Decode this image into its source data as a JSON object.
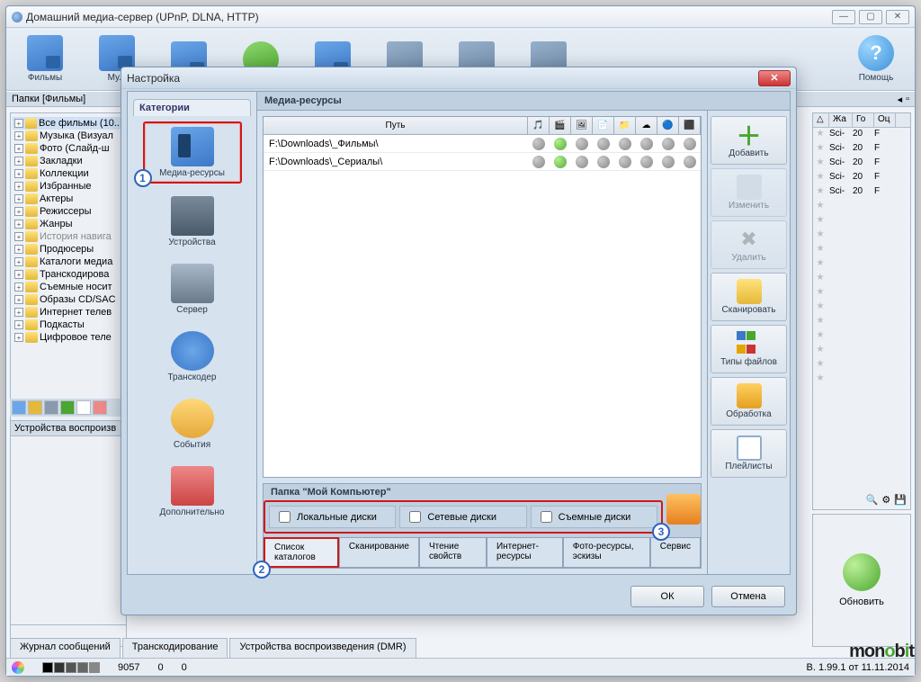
{
  "window": {
    "title": "Домашний медиа-сервер (UPnP, DLNA, HTTP)"
  },
  "toolbar": {
    "items": [
      "Фильмы",
      "Му...",
      "",
      "",
      "",
      "",
      "",
      "",
      ""
    ],
    "help": "Помощь"
  },
  "secondBar": {
    "left": "Папки [Фильмы]"
  },
  "tree": [
    {
      "label": "Все фильмы (10...",
      "sel": true
    },
    {
      "label": "Музыка (Визуал"
    },
    {
      "label": "Фото (Слайд-ш"
    },
    {
      "label": "Закладки"
    },
    {
      "label": "Коллекции"
    },
    {
      "label": "Избранные"
    },
    {
      "label": "Актеры"
    },
    {
      "label": "Режиссеры"
    },
    {
      "label": "Жанры"
    },
    {
      "label": "История навига",
      "grey": true
    },
    {
      "label": "Продюсеры"
    },
    {
      "label": "Каталоги медиа"
    },
    {
      "label": "Транскодирова"
    },
    {
      "label": "Съемные носит"
    },
    {
      "label": "Образы CD/SAC"
    },
    {
      "label": "Интернет телев"
    },
    {
      "label": "Подкасты"
    },
    {
      "label": "Цифровое теле"
    }
  ],
  "devicesPane": {
    "title": "Устройства воспроизв"
  },
  "rightColumns": [
    "△",
    "Жа",
    "Го",
    "Оц"
  ],
  "rightRows": [
    {
      "c1": "",
      "c2": "Sci-",
      "c3": "20",
      "c4": "F"
    },
    {
      "c1": "",
      "c2": "Sci-",
      "c3": "20",
      "c4": "F"
    },
    {
      "c1": "",
      "c2": "Sci-",
      "c3": "20",
      "c4": "F"
    },
    {
      "c1": "",
      "c2": "Sci-",
      "c3": "20",
      "c4": "F"
    },
    {
      "c1": "",
      "c2": "Sci-",
      "c3": "20",
      "c4": "F"
    }
  ],
  "bottomTabs": [
    "Журнал сообщений",
    "Транскодирование",
    "Устройства воспроизведения (DMR)"
  ],
  "status": {
    "n1": "9057",
    "n2": "0",
    "n3": "0",
    "ver": "B. 1.99.1 от 11.11.2014"
  },
  "rightBtn": {
    "refresh": "Обновить"
  },
  "settings": {
    "title": "Настройка",
    "catTab": "Категории",
    "cats": [
      "Медиа-ресурсы",
      "Устройства",
      "Сервер",
      "Транскодер",
      "События",
      "Дополнительно"
    ],
    "panelTitle": "Медиа-ресурсы",
    "pathCol": "Путь",
    "rows": [
      "F:\\Downloads\\_Фильмы\\",
      "F:\\Downloads\\_Сериалы\\"
    ],
    "actions": [
      "Добавить",
      "Изменить",
      "Удалить",
      "Сканировать",
      "Типы файлов",
      "Обработка",
      "Плейлисты"
    ],
    "lowerTitle": "Папка \"Мой Компьютер\"",
    "checks": [
      "Локальные диски",
      "Сетевые диски",
      "Съемные диски"
    ],
    "lowerTabs": [
      "Список каталогов",
      "Сканирование",
      "Чтение свойств",
      "Интернет-ресурсы",
      "Фото-ресурсы, эскизы",
      "Сервис"
    ],
    "ok": "ОК",
    "cancel": "Отмена"
  },
  "badges": {
    "b1": "1",
    "b2": "2",
    "b3": "3"
  }
}
